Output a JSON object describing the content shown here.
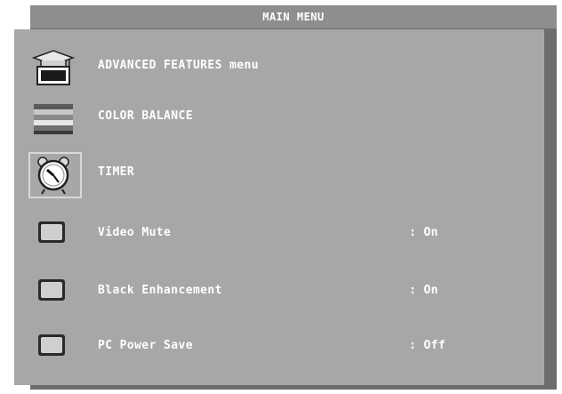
{
  "menu": {
    "title": "MAIN MENU",
    "items": [
      {
        "label": "ADVANCED FEATURES menu",
        "value": "",
        "icon": "graduation-cap-icon"
      },
      {
        "label": "COLOR BALANCE",
        "value": "",
        "icon": "color-bars-icon"
      },
      {
        "label": "TIMER",
        "value": "",
        "icon": "alarm-clock-icon"
      },
      {
        "label": "Video Mute",
        "value": ": On",
        "icon": "checkbox-icon"
      },
      {
        "label": "Black Enhancement",
        "value": ": On",
        "icon": "checkbox-icon"
      },
      {
        "label": "PC Power Save",
        "value": ": Off",
        "icon": "checkbox-icon"
      }
    ]
  },
  "colors": {
    "panel": "#a7a7a7",
    "title_bar": "#8e8e8e",
    "shadow": "#6d6d6d",
    "text": "#ffffff"
  }
}
